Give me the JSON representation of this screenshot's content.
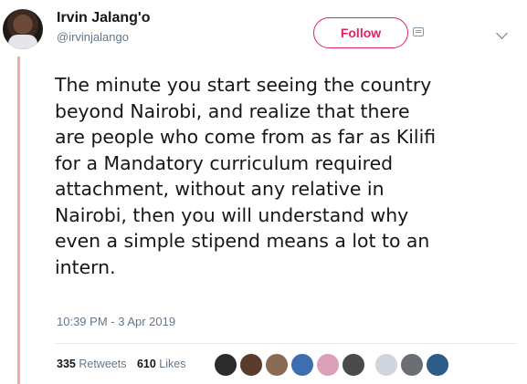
{
  "user": {
    "display_name": "Irvin Jalang'o",
    "handle": "@irvinjalango"
  },
  "follow_label": "Follow",
  "tweet": {
    "lines": [
      "The minute you start seeing the country",
      "beyond Nairobi, and realize that there",
      "are people who come from as far as Kilifi",
      "for a Mandatory curriculum required",
      "attachment, without any relative in",
      "Nairobi, then you will understand why",
      "even a simple stipend means a lot to an",
      "intern."
    ],
    "timestamp": "10:39 PM - 3 Apr 2019"
  },
  "stats": {
    "retweets_count": "335",
    "retweets_label": "Retweets",
    "likes_count": "610",
    "likes_label": "Likes"
  },
  "likers": [
    {
      "color": "#2b2b2b"
    },
    {
      "color": "#5a3b2c"
    },
    {
      "color": "#8a6a52"
    },
    {
      "color": "#3d6fb0"
    },
    {
      "color": "#d9a0b8"
    },
    {
      "color": "#4a4a4a"
    },
    {
      "color": "#cfd6dd"
    },
    {
      "color": "#6b6f74"
    },
    {
      "color": "#2e5c8a"
    }
  ]
}
